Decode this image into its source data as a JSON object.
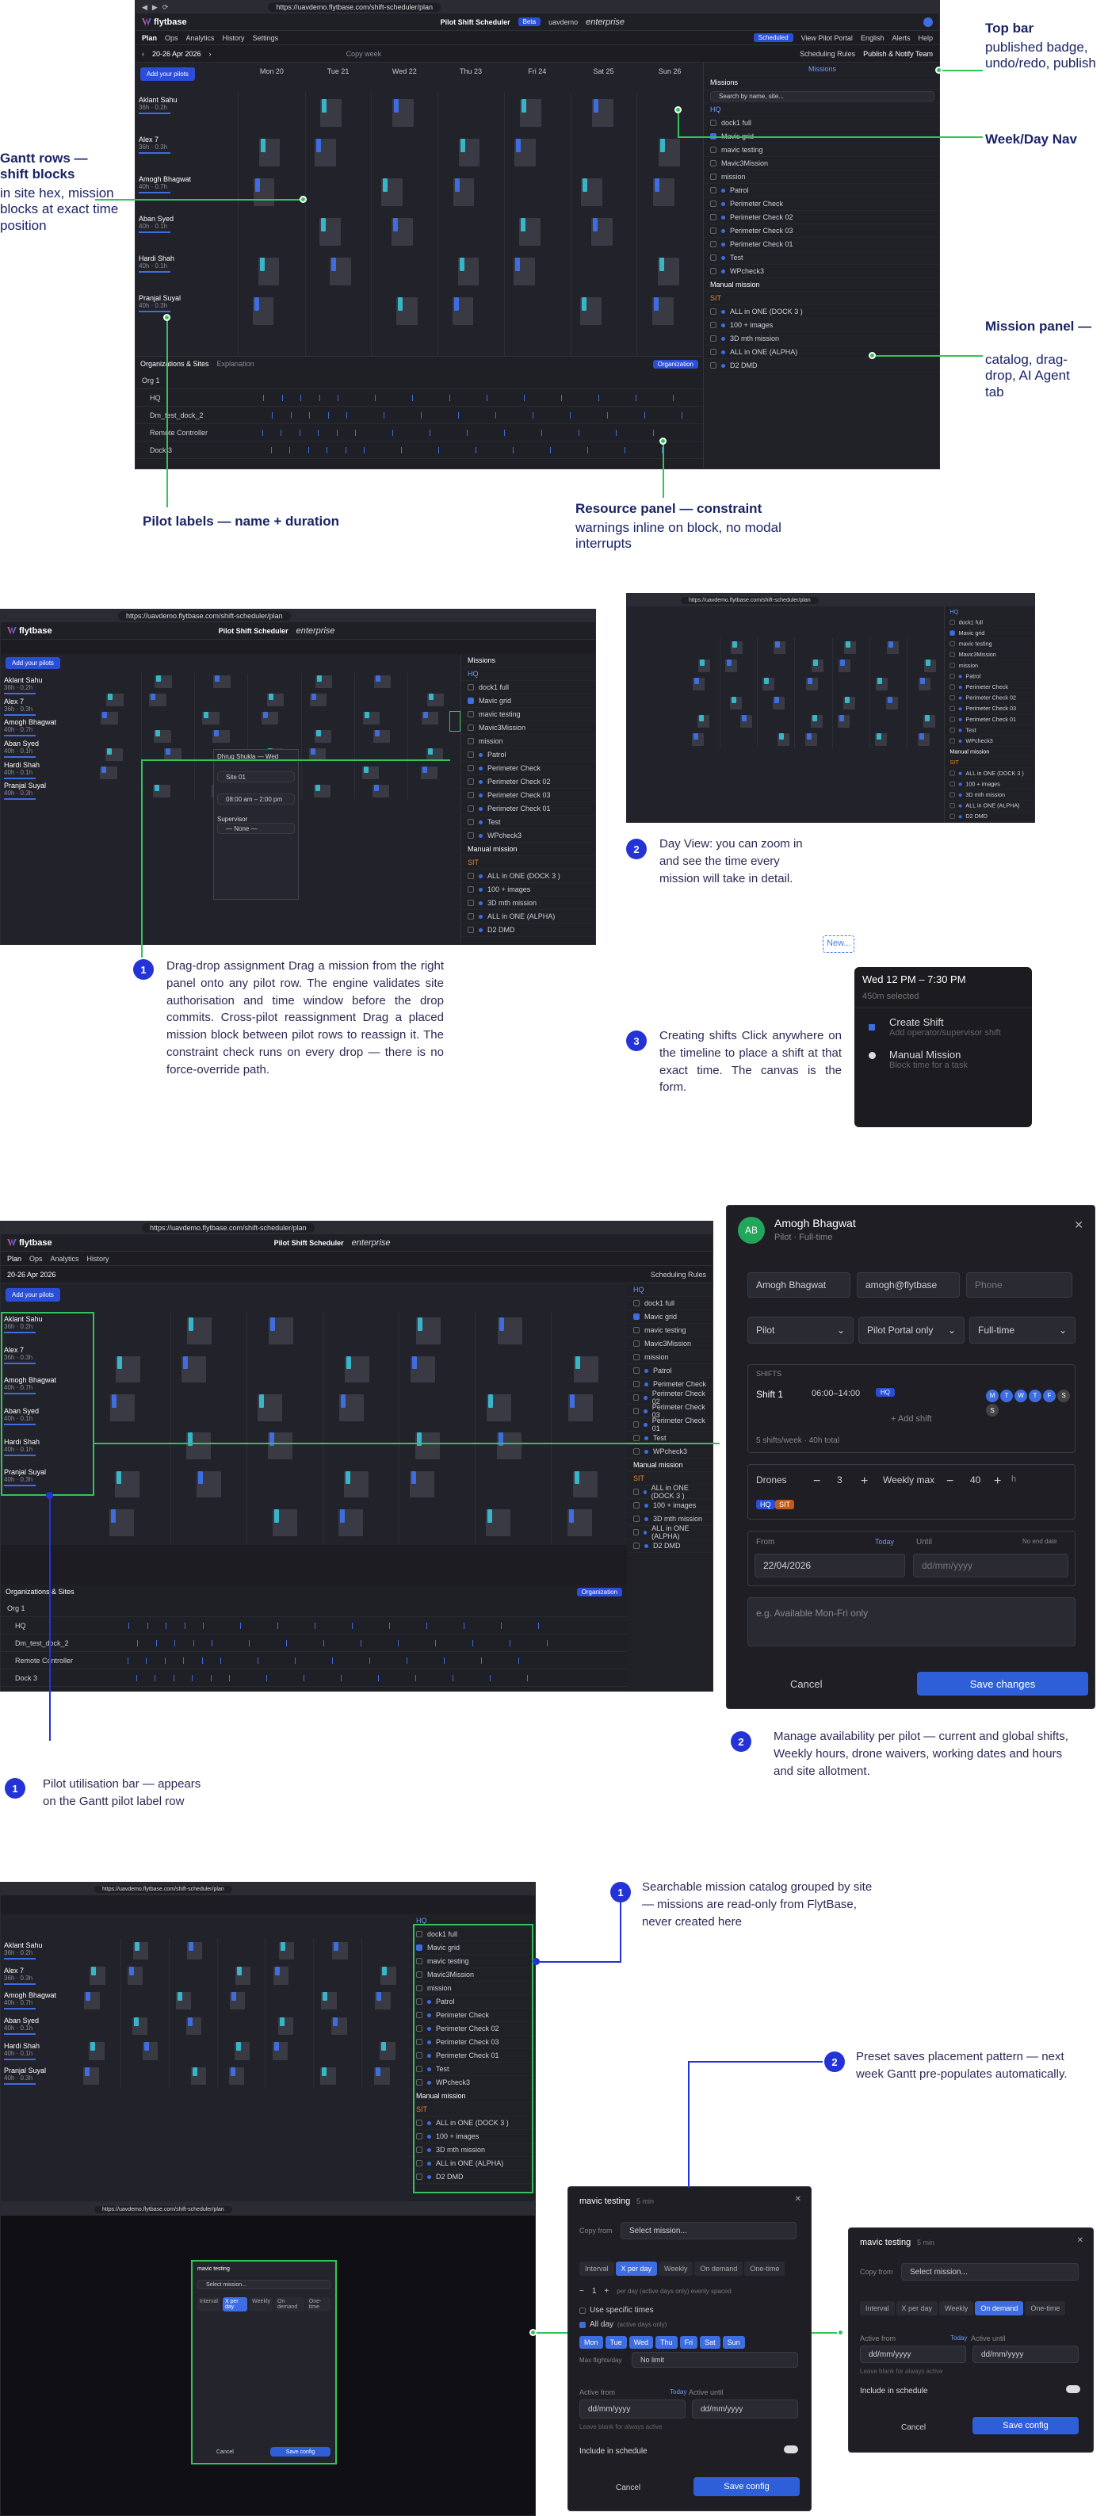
{
  "browser": {
    "url_main": "https://uavdemo.flytbase.com/shift-scheduler/plan"
  },
  "app": {
    "brand": "flytbase",
    "title": "Pilot Shift Scheduler",
    "beta": "Beta",
    "org": "uavdemo",
    "enterprise": "enterprise",
    "menu": [
      "Plan",
      "Ops",
      "Analytics",
      "History",
      "Settings"
    ],
    "right_menu": [
      "Scheduled",
      "View Pilot Portal",
      "English",
      "Alerts",
      "Help"
    ],
    "date_range": "20-26 Apr 2026",
    "copy_week": "Copy week",
    "scheduling_rules": "Scheduling Rules",
    "publish": "Publish & Notify Team",
    "add_pilots": "Add your pilots",
    "days": [
      "Mon 20",
      "Tue 21",
      "Wed 22",
      "Thu 23",
      "Fri 24",
      "Sat 25",
      "Sun 26"
    ],
    "pilots": [
      {
        "name": "Aklant Sahu",
        "meta": "36h · 0.2h"
      },
      {
        "name": "Alex 7",
        "meta": "36h · 0.3h"
      },
      {
        "name": "Amogh Bhagwat",
        "meta": "40h · 0.7h"
      },
      {
        "name": "Aban Syed",
        "meta": "40h · 0.1h"
      },
      {
        "name": "Hardi Shah",
        "meta": "40h · 0.1h"
      },
      {
        "name": "Pranjal Suyal",
        "meta": "40h · 0.3h"
      }
    ],
    "missions_tab": "Missions",
    "search_placeholder": "Search by name, site...",
    "site_hq": "HQ",
    "missions_hq": [
      "dock1 full",
      "Mavic grid",
      "mavic testing",
      "Mavic3Mission",
      "mission",
      "Patrol",
      "Perimeter Check",
      "Perimeter Check 02",
      "Perimeter Check 03",
      "Perimeter Check 01",
      "Test",
      "WPcheck3"
    ],
    "manual_mission": "Manual mission",
    "site_sit": "SIT",
    "missions_sit": [
      "ALL in ONE (DOCK 3 )",
      "100 + images",
      "3D mth mission",
      "ALL in ONE (ALPHA)",
      "D2 DMD"
    ],
    "resource_tabs": [
      "Organizations & Sites",
      "Explanation"
    ],
    "organization_btn": "Organization",
    "resource_rows": [
      "Org 1",
      "HQ",
      "Dm_test_dock_2",
      "Remote Controller",
      "Dock 3"
    ]
  },
  "callouts_top": {
    "top_bar": {
      "title": "Top bar",
      "sub": "published badge, undo/redo, publish"
    },
    "week_nav": {
      "title": "Week/Day Nav"
    },
    "gantt_rows": {
      "title": "Gantt rows — shift blocks",
      "sub": "in site hex, mission blocks at exact time position"
    },
    "mission_panel": {
      "title": "Mission panel —",
      "sub": "catalog, drag-drop, AI Agent tab"
    },
    "pilot_labels": {
      "title": "Pilot labels — name + duration"
    },
    "resource_panel": {
      "title": "Resource panel — constraint",
      "sub": "warnings inline on block, no modal interrupts"
    }
  },
  "section2": {
    "drag_drop": "Drag-drop assignment Drag a mission from the right panel onto any pilot row. The engine validates site authorisation and time window before the drop commits. Cross-pilot reassignment Drag a placed mission block between pilot rows to reassign it. The constraint check runs on every drop — there is no force-override path.",
    "day_view": "Day View: you can zoom in and see the time every mission will take in detail.",
    "creating": "Creating shifts Click anywhere on the timeline to place a shift at that exact time. The canvas is the form.",
    "popup": {
      "new_label": "New...",
      "time": "Wed 12 PM – 7:30 PM",
      "duration": "450m selected",
      "create_shift": "Create Shift",
      "create_shift_sub": "Add operator/supervisor shift",
      "manual_mission": "Manual Mission",
      "manual_mission_sub": "Block time for a task"
    },
    "overlay": {
      "title": "Dhrug Shukla — Wed",
      "site": "Site 01",
      "window": "08:00 am – 2:00 pm",
      "supervisor": "Supervisor",
      "none": "— None —"
    }
  },
  "section3": {
    "utilisation": "Pilot utilisation bar — appears on the Gantt pilot label row",
    "manage": "Manage availability per pilot — current and global shifts, Weekly hours, drone waivers, working dates and hours and site allotment.",
    "pilot_panel": {
      "initials": "AB",
      "name": "Amogh Bhagwat",
      "role": "Pilot · Full-time",
      "name_field": "Amogh Bhagwat",
      "email_field": "amogh@flytbase",
      "phone_placeholder": "Phone",
      "role_field": "Pilot",
      "portal_field": "Pilot Portal only",
      "type_field": "Full-time",
      "shifts_label": "SHIFTS",
      "shift_name": "Shift 1",
      "shift_time": "06:00–14:00",
      "shift_site": "HQ",
      "shift_days": [
        "M",
        "T",
        "W",
        "T",
        "F",
        "S",
        "S"
      ],
      "add_shift": "+ Add shift",
      "shift_summary": "5 shifts/week · 40h total",
      "drones_label": "Drones",
      "drones_value": "3",
      "weekly_max_label": "Weekly max",
      "weekly_max_value": "40",
      "hours_unit": "h",
      "site_tags": [
        "HQ",
        "SIT"
      ],
      "from_label": "From",
      "today_label": "Today",
      "until_label": "Until",
      "no_end_label": "No end date",
      "from_value": "22/04/2026",
      "until_placeholder": "dd/mm/yyyy",
      "notes_placeholder": "e.g. Available Mon-Fri only",
      "cancel": "Cancel",
      "save": "Save changes"
    }
  },
  "section4": {
    "catalog": "Searchable mission catalog grouped by site — missions are read-only from FlytBase, never created here",
    "preset": "Preset saves placement pattern — next week Gantt pre-populates automatically.",
    "modal_big": {
      "mission": "mavic testing",
      "mins": "5 min",
      "copy_from": "Copy from",
      "select_mission": "Select mission...",
      "freq_tabs": [
        "Interval",
        "X per day",
        "Weekly",
        "On demand",
        "One-time"
      ],
      "repeat_label": "1",
      "per_day_hint": "per day (active days only) evenly spaced",
      "use_specific": "Use specific times",
      "all_day": "All day",
      "all_day_hint": "(active days only)",
      "days": [
        "Mon",
        "Tue",
        "Wed",
        "Thu",
        "Fri",
        "Sat",
        "Sun"
      ],
      "max_flights_label": "Max flights/day",
      "max_flights_value": "No limit",
      "active_from": "Active from",
      "active_until": "Active until",
      "today": "Today",
      "date_placeholder": "dd/mm/yyyy",
      "blank_hint": "Leave blank for always active",
      "include": "Include in schedule",
      "cancel": "Cancel",
      "save": "Save config"
    },
    "modal_small": {
      "mission": "mavic testing",
      "mins": "5 min",
      "copy_from": "Copy from",
      "select_mission": "Select mission...",
      "freq_tabs": [
        "Interval",
        "X per day",
        "Weekly",
        "On demand",
        "One-time"
      ],
      "active_from": "Active from",
      "active_until": "Active until",
      "today": "Today",
      "date_placeholder": "dd/mm/yyyy",
      "blank_hint": "Leave blank for always active",
      "include": "Include in schedule",
      "cancel": "Cancel",
      "save": "Save config"
    }
  },
  "colors": {
    "accent": "#2333d6",
    "green": "#33c35b",
    "orange": "#e0872f",
    "cyan": "#38b6c9",
    "dark": "#1c1c22"
  }
}
